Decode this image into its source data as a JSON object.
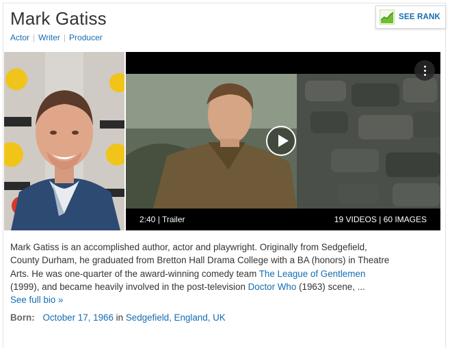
{
  "person": {
    "name": "Mark Gatiss",
    "roles": [
      "Actor",
      "Writer",
      "Producer"
    ]
  },
  "see_rank": {
    "label": "SEE RANK",
    "icon": "rank-chart-icon"
  },
  "video": {
    "duration": "2:40",
    "separator": "|",
    "kind": "Trailer",
    "videos_count": "19 VIDEOS",
    "images_count": "60 IMAGES"
  },
  "bio": {
    "line1": "Mark Gatiss is an accomplished author, actor and playwright. Originally from Sedgefield,",
    "line2": "County Durham, he graduated from Bretton Hall Drama College with a BA (honors) in Theatre",
    "line3_pre": "Arts. He was one-quarter of the award-winning comedy team ",
    "link_league": "The League of Gentlemen",
    "line4_pre": "(1999), and became heavily involved in the post-television ",
    "link_doctor": "Doctor Who",
    "line4_post": " (1963) scene, ...",
    "see_full_bio": "See full bio »"
  },
  "born": {
    "label": "Born:",
    "date": "October 17, 1966",
    "in": "in",
    "place": "Sedgefield, England, UK"
  },
  "colors": {
    "link": "#136cb2",
    "rank_green": "#6fbf2f"
  }
}
